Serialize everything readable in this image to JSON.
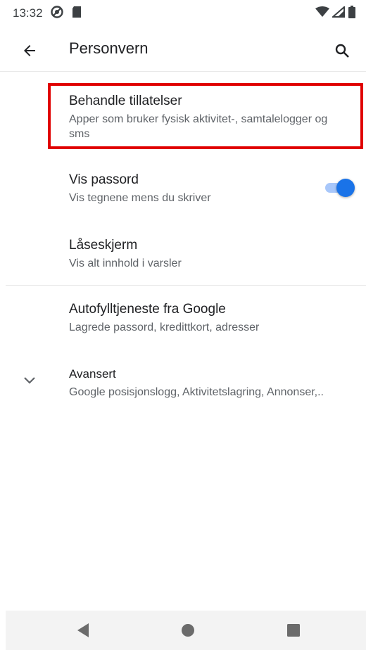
{
  "status_bar": {
    "time": "13:32"
  },
  "app_bar": {
    "title": "Personvern"
  },
  "prefs": {
    "manage_permissions": {
      "title": "Behandle tillatelser",
      "summary": "Apper som bruker fysisk aktivitet-, samtalelogger og sms"
    },
    "show_passwords": {
      "title": "Vis passord",
      "summary": "Vis tegnene mens du skriver",
      "enabled": true
    },
    "lock_screen": {
      "title": "Låseskjerm",
      "summary": "Vis alt innhold i varsler"
    },
    "autofill": {
      "title": "Autofylltjeneste fra Google",
      "summary": "Lagrede passord, kredittkort, adresser"
    },
    "advanced": {
      "title": "Avansert",
      "summary": "Google posisjonslogg, Aktivitetslagring, Annonser,.."
    }
  },
  "colors": {
    "accent": "#1a73e8",
    "highlight": "#e00000"
  },
  "icons": [
    "back-arrow-icon",
    "search-icon",
    "chevron-down-icon",
    "nav-back-icon",
    "nav-home-icon",
    "nav-recents-icon"
  ]
}
